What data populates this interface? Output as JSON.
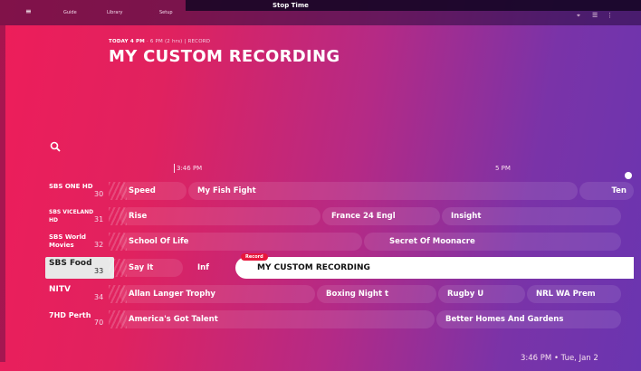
{
  "top_nav": {
    "guide": "Guide",
    "library": "Library",
    "setup": "Setup"
  },
  "stop_time_label": "Stop Time",
  "recording": {
    "meta_day_time": "TODAY 4 PM",
    "meta_detail": "· 6 PM (2 hrs) | RECORD",
    "title": "MY CUSTOM RECORDING"
  },
  "timeline": {
    "mark1": "3:46 PM",
    "mark2": "5 PM"
  },
  "channels": [
    {
      "logo": "SBS ONE HD",
      "number": "30",
      "programs": [
        "Speed",
        "My Fish Fight",
        "Ten"
      ]
    },
    {
      "logo": "SBS VICELAND HD",
      "number": "31",
      "programs": [
        "Rise",
        "France 24 Engl",
        "Insight"
      ]
    },
    {
      "logo": "SBS World Movies",
      "number": "32",
      "programs": [
        "School Of Life",
        "Secret Of Moonacre"
      ]
    },
    {
      "logo": "SBS Food",
      "number": "33",
      "programs": [
        "Say It",
        "Inf",
        "MY CUSTOM RECORDING"
      ],
      "badge": "Record"
    },
    {
      "logo": "NITV",
      "number": "34",
      "programs": [
        "Allan Langer Trophy",
        "Boxing Night t",
        "Rugby U",
        "NRL WA Prem"
      ]
    },
    {
      "logo": "7HD Perth",
      "number": "70",
      "programs": [
        "America's Got Talent",
        "Better Homes And Gardens"
      ]
    }
  ],
  "clock": "3:46 PM • Tue, Jan 2",
  "colors": {
    "gradient_start": "#ee1d5a",
    "gradient_end": "#6a35b0",
    "record_red": "#e8173c"
  }
}
